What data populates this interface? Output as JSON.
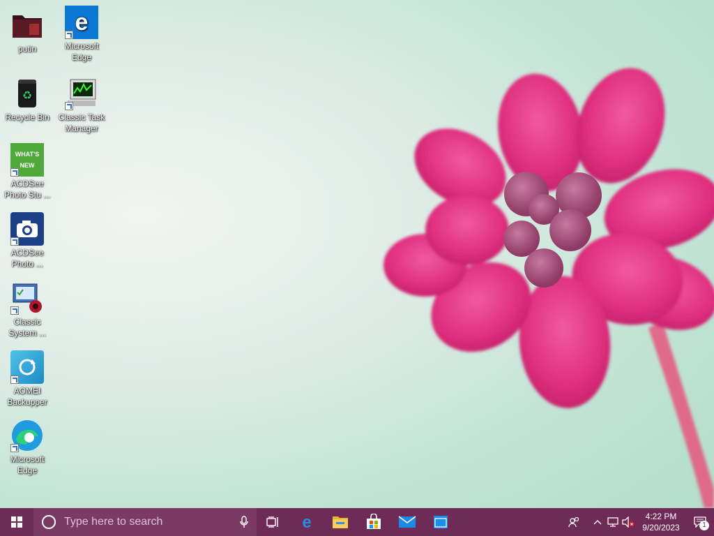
{
  "desktop": {
    "icons": [
      {
        "label": "putin",
        "icon": "folder-icon"
      },
      {
        "label": "Microsoft Edge",
        "icon": "edge-legacy-icon"
      },
      {
        "label": "Recycle Bin",
        "icon": "recycle-bin-icon"
      },
      {
        "label": "Classic Task Manager",
        "icon": "task-manager-icon"
      },
      {
        "label": "ACDSee Photo Stu ...",
        "icon": "acdsee-whats-new-icon"
      },
      {
        "label": "ACDSee Photo ...",
        "icon": "acdsee-camera-icon"
      },
      {
        "label": "Classic System ...",
        "icon": "system-config-icon"
      },
      {
        "label": "AOMEI Backupper",
        "icon": "aomei-backupper-icon"
      },
      {
        "label": "Microsoft Edge",
        "icon": "edge-icon"
      }
    ],
    "whats_new_text": "WHAT'S NEW"
  },
  "taskbar": {
    "search_placeholder": "Type here to search",
    "apps": [
      "task-view-icon",
      "edge-icon",
      "file-explorer-icon",
      "store-icon",
      "mail-icon",
      "window-app-icon"
    ],
    "clock_time": "4:22 PM",
    "clock_date": "9/20/2023",
    "notification_count": "1"
  },
  "colors": {
    "taskbar": "#6e2b55",
    "search_box": "#7b3a63",
    "accent": "#0078d7"
  }
}
